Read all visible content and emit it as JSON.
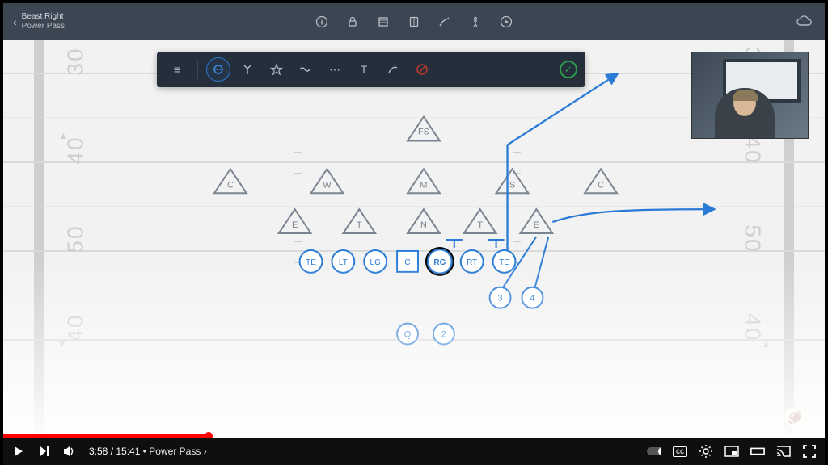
{
  "app": {
    "back_label": "Beast Right",
    "subtitle": "Power Pass"
  },
  "top_icons": [
    "info",
    "lock",
    "grid",
    "panel",
    "draw",
    "run",
    "play-circle"
  ],
  "toolbar": {
    "items": [
      "drag-handle",
      "",
      "selected-pos",
      "route-branch",
      "star",
      "wave",
      "more",
      "text",
      "curve",
      "erase"
    ],
    "text_tool_label": "T"
  },
  "field": {
    "numbers_left": [
      "30",
      "40",
      "50",
      "40"
    ],
    "numbers_right": [
      "30",
      "40",
      "50",
      "40"
    ]
  },
  "diagram": {
    "defense_top": {
      "label": "FS"
    },
    "defense_row2": [
      "C",
      "W",
      "M",
      "S",
      "C"
    ],
    "defense_row3": [
      "E",
      "T",
      "N",
      "T",
      "E"
    ],
    "offense_line": [
      "TE",
      "LT",
      "LG",
      "C",
      "RG",
      "RT",
      "TE"
    ],
    "backs": [
      "3",
      "4"
    ],
    "qb_row": [
      "Q",
      "2"
    ]
  },
  "youtube": {
    "current_time": "3:58",
    "duration": "15:41",
    "chapter": "Power Pass",
    "progress_pct": 25
  },
  "colors": {
    "route": "#2a7bd6",
    "defender": "#7a8591",
    "offense": "#2a7bd6"
  }
}
